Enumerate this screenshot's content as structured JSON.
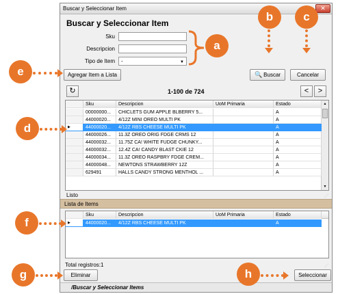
{
  "window": {
    "title": "Buscar y Seleccionar Item",
    "close_glyph": "✕"
  },
  "form": {
    "heading": "Buscar y Seleccionar Item",
    "sku_label": "Sku",
    "sku_value": "",
    "descripcion_label": "Descripcion",
    "descripcion_value": "",
    "tipo_label": "Tipo de Item",
    "tipo_value": "-"
  },
  "buttons": {
    "agregar": "Agregar Item a Lista",
    "buscar": "Buscar",
    "cancelar": "Cancelar",
    "eliminar": "Eliminar",
    "seleccionar": "Seleccionar"
  },
  "pager": {
    "range": "1-100 de 724",
    "prev": "<",
    "next": ">",
    "refresh_icon": "refresh-icon"
  },
  "grid": {
    "columns": [
      "Sku",
      "Descripcion",
      "UoM Primaria",
      "Estado"
    ],
    "rows": [
      {
        "sku": "00000000...",
        "desc": "CHICLETS GUM APPLE BLBERRY 5...",
        "uom": "",
        "estado": "A",
        "selected": false
      },
      {
        "sku": "44000020...",
        "desc": "4/12Z MINI OREO MULTI PK",
        "uom": "",
        "estado": "A",
        "selected": false
      },
      {
        "sku": "44000020...",
        "desc": "4/12Z RBS CHEESE MULTI PK",
        "uom": "",
        "estado": "A",
        "selected": true
      },
      {
        "sku": "44000026...",
        "desc": "11.3Z OREO ORIG FDGE CRMS 12",
        "uom": "",
        "estado": "A",
        "selected": false
      },
      {
        "sku": "44000032...",
        "desc": "11.75Z CA! WHITE FUDGE CHUNKY...",
        "uom": "",
        "estado": "A",
        "selected": false
      },
      {
        "sku": "44000032...",
        "desc": "12.4Z CA! CANDY BLAST CKIE 12",
        "uom": "",
        "estado": "A",
        "selected": false
      },
      {
        "sku": "44000034...",
        "desc": "11.3Z OREO RASPBRY FDGE CREM...",
        "uom": "",
        "estado": "A",
        "selected": false
      },
      {
        "sku": "44000048...",
        "desc": "NEWTONS STRAWBERRY 12Z",
        "uom": "",
        "estado": "A",
        "selected": false
      },
      {
        "sku": "629491",
        "desc": "HALLS CANDY STRONG MENTHOL ...",
        "uom": "",
        "estado": "A",
        "selected": false
      }
    ],
    "status": "Listo"
  },
  "list": {
    "title": "Lista de Items",
    "columns": [
      "Sku",
      "Descripcion",
      "UoM Primaria",
      "Estado"
    ],
    "rows": [
      {
        "sku": "44000020...",
        "desc": "4/12Z RBS CHEESE MULTI PK",
        "uom": "",
        "estado": "A",
        "selected": true
      }
    ],
    "total": "Total registros:1"
  },
  "footer": {
    "breadcrumb": "/Buscar y Seleccionar Items"
  },
  "callouts": {
    "a": "a",
    "b": "b",
    "c": "c",
    "d": "d",
    "e": "e",
    "f": "f",
    "g": "g",
    "h": "h"
  },
  "colors": {
    "callout": "#e8762a",
    "selection": "#3399ff",
    "section_band": "#d5bfa1"
  }
}
